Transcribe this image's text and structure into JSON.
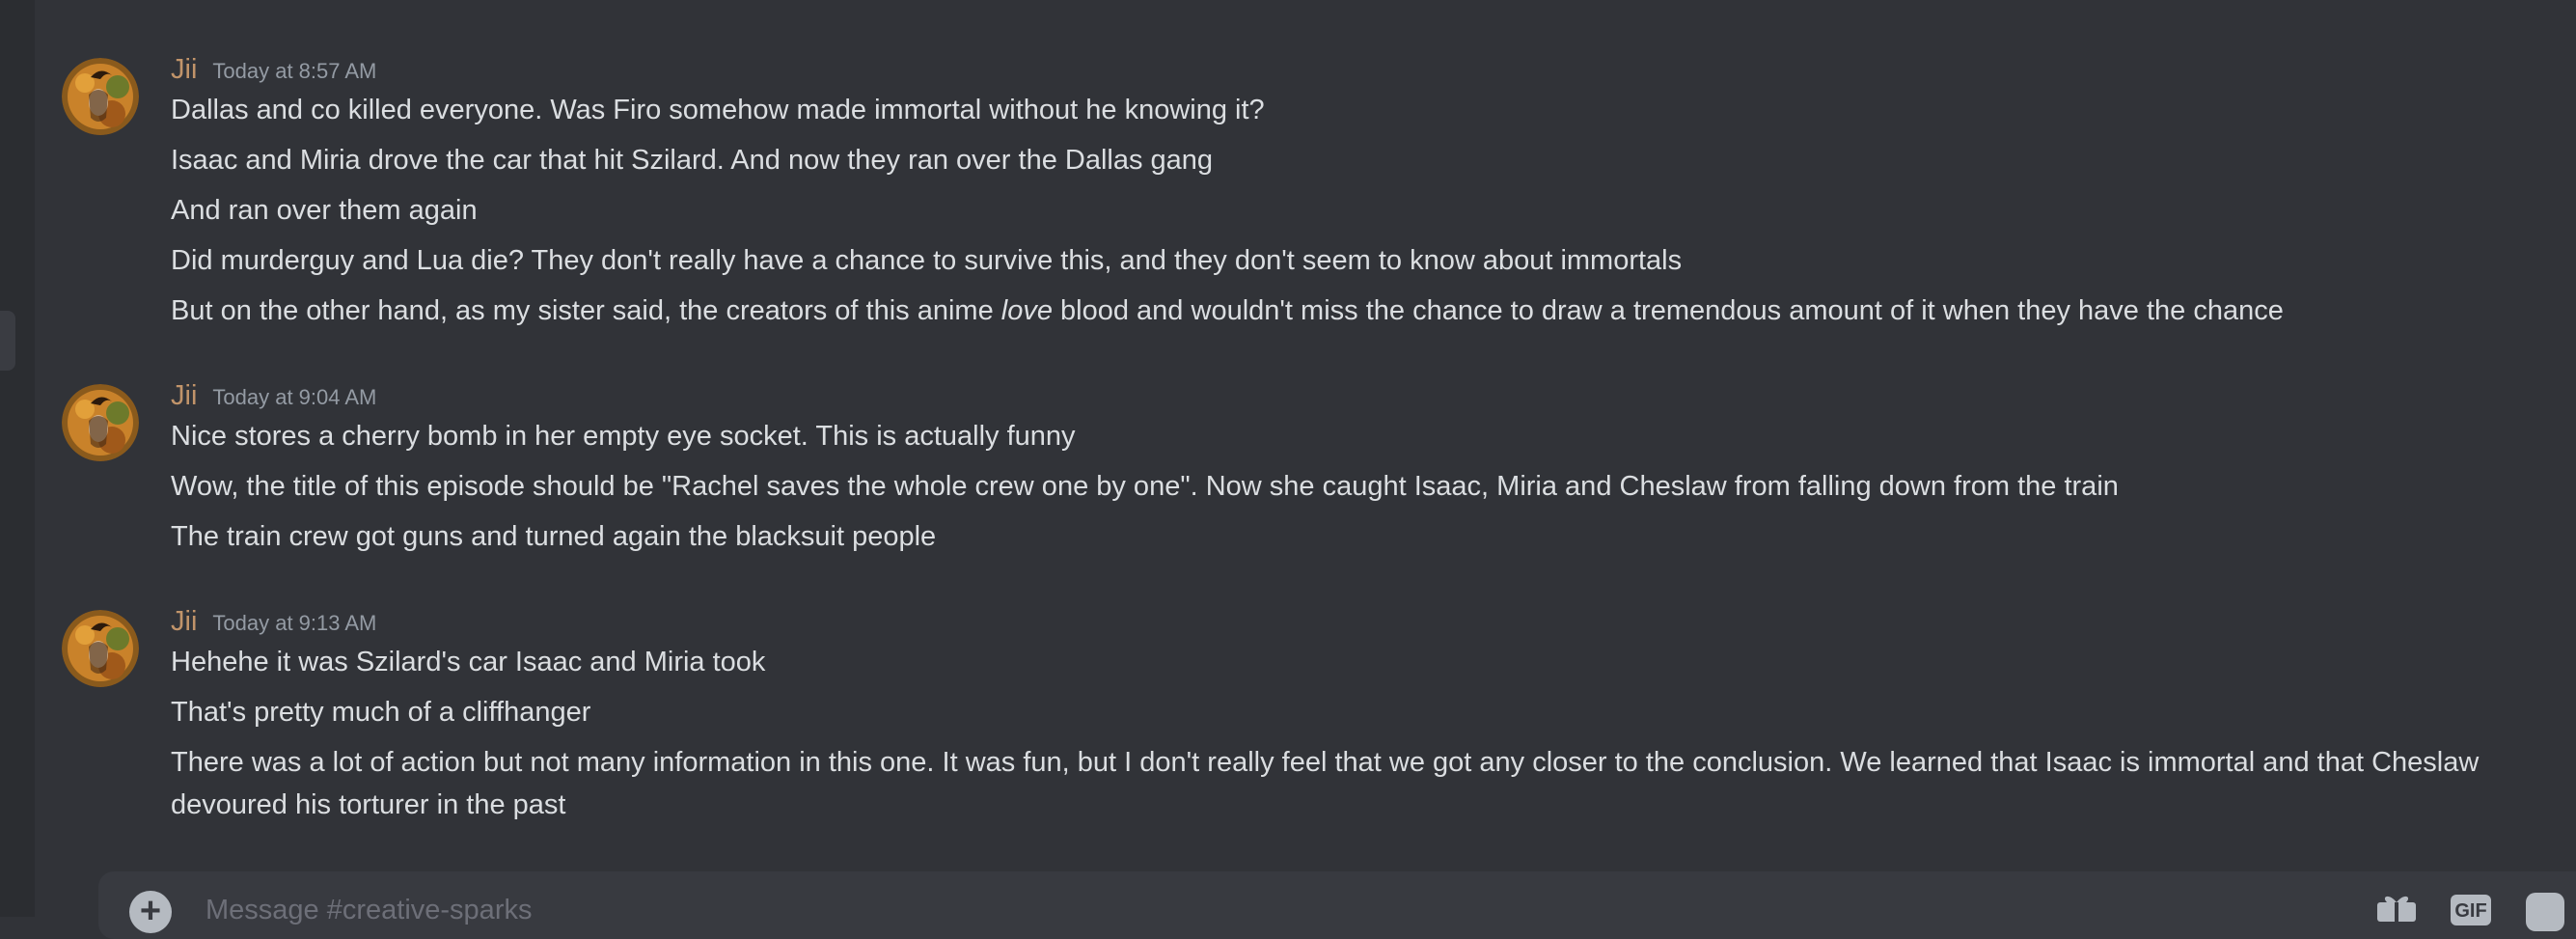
{
  "colors": {
    "background": "#313338",
    "author": "#c1946a",
    "text": "#dbdee1",
    "timestamp": "#949ba4"
  },
  "messages": [
    {
      "author": "Jii",
      "timestamp": "Today at 8:57 AM",
      "lines": [
        {
          "text": "Dallas and co killed everyone. Was Firo somehow made immortal without he knowing it?"
        },
        {
          "text": "Isaac and Miria drove the car that hit Szilard. And now they ran over the Dallas gang"
        },
        {
          "text": "And ran over them again"
        },
        {
          "text": "Did murderguy and Lua die? They don't really have a chance to survive this, and they don't seem to know about immortals"
        },
        {
          "pre": "But on the other hand, as my sister said, the creators of this anime ",
          "em": "love",
          "post": " blood and wouldn't miss the chance to draw a tremendous amount of it when they have the chance"
        }
      ]
    },
    {
      "author": "Jii",
      "timestamp": "Today at 9:04 AM",
      "lines": [
        {
          "text": "Nice stores a cherry bomb in her empty eye socket. This is actually funny"
        },
        {
          "text": "Wow, the title of this episode should be \"Rachel saves the whole crew one by one\". Now she caught Isaac, Miria and Cheslaw from falling down from the train"
        },
        {
          "text": "The train crew got guns and turned again the blacksuit people"
        }
      ]
    },
    {
      "author": "Jii",
      "timestamp": "Today at 9:13 AM",
      "lines": [
        {
          "text": "Hehehe it was Szilard's car Isaac and Miria took"
        },
        {
          "text": "That's pretty much of a cliffhanger"
        },
        {
          "text": "There was a lot of action but not many information in this one. It was fun, but I don't really feel that we got any closer to the conclusion. We learned that Isaac is immortal and that Cheslaw devoured his torturer in the past"
        }
      ]
    }
  ],
  "composer": {
    "placeholder": "Message #creative-sparks",
    "add_icon": "plus-circle-icon",
    "gift_icon": "gift-icon",
    "gif_label": "GIF",
    "sticker_icon": "sticker-icon"
  }
}
